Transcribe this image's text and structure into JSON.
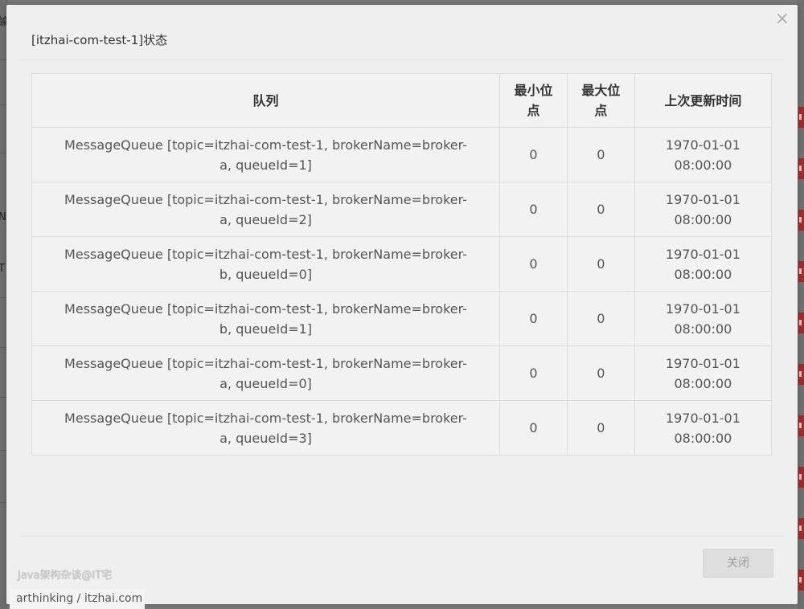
{
  "dialog": {
    "title": "[itzhai-com-test-1]状态",
    "close_icon": "×",
    "close_button_label": "关闭"
  },
  "table": {
    "headers": [
      "队列",
      "最小位点",
      "最大位点",
      "上次更新时间"
    ],
    "rows": [
      {
        "queue": "MessageQueue [topic=itzhai-com-test-1, brokerName=broker-a, queueId=1]",
        "min": "0",
        "max": "0",
        "updated": "1970-01-01 08:00:00"
      },
      {
        "queue": "MessageQueue [topic=itzhai-com-test-1, brokerName=broker-a, queueId=2]",
        "min": "0",
        "max": "0",
        "updated": "1970-01-01 08:00:00"
      },
      {
        "queue": "MessageQueue [topic=itzhai-com-test-1, brokerName=broker-b, queueId=0]",
        "min": "0",
        "max": "0",
        "updated": "1970-01-01 08:00:00"
      },
      {
        "queue": "MessageQueue [topic=itzhai-com-test-1, brokerName=broker-b, queueId=1]",
        "min": "0",
        "max": "0",
        "updated": "1970-01-01 08:00:00"
      },
      {
        "queue": "MessageQueue [topic=itzhai-com-test-1, brokerName=broker-a, queueId=0]",
        "min": "0",
        "max": "0",
        "updated": "1970-01-01 08:00:00"
      },
      {
        "queue": "MessageQueue [topic=itzhai-com-test-1, brokerName=broker-a, queueId=3]",
        "min": "0",
        "max": "0",
        "updated": "1970-01-01 08:00:00"
      }
    ]
  },
  "background": {
    "left_glyphs": [
      "論",
      "N",
      "T"
    ]
  },
  "watermarks": {
    "line1": "Java架构杂谈@IT宅",
    "line2": "arthinking / itzhai.com"
  }
}
